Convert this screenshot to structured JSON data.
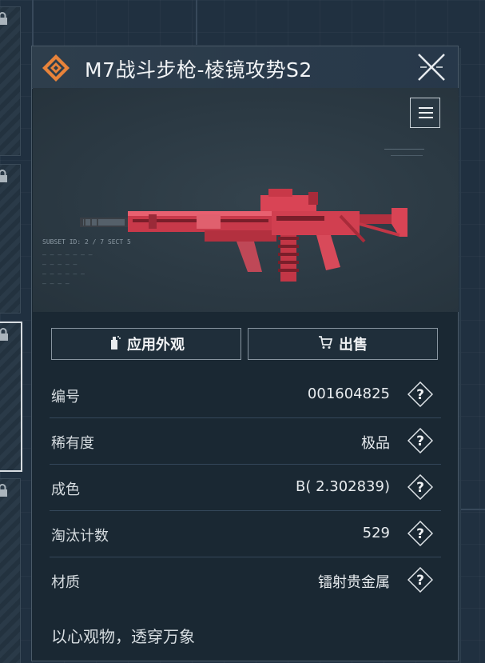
{
  "window": {
    "title": "M7战斗步枪-棱镜攻势S2"
  },
  "preview": {
    "hud_lines": [
      "SUBSET ID: 2 / 7 SECT 5",
      "— — — — — — —",
      "— — — — —",
      "— — — — — —",
      "— — — —"
    ]
  },
  "actions": {
    "apply_label": "应用外观",
    "sell_label": "出售"
  },
  "details": [
    {
      "label": "编号",
      "value": "001604825"
    },
    {
      "label": "稀有度",
      "value": "极品"
    },
    {
      "label": "成色",
      "value": "B( 2.302839)"
    },
    {
      "label": "淘汰计数",
      "value": "529"
    },
    {
      "label": "材质",
      "value": "镭射贵金属"
    }
  ],
  "flavor_text": "以心观物，透穿万象",
  "colors": {
    "accent_orange": "#e8833a",
    "weapon_red": "#d6404e",
    "panel_bg": "#1a2833"
  },
  "icons": {
    "title": "diamond-emblem-icon",
    "close": "close-icon",
    "list": "list-icon",
    "apply": "spray-can-icon",
    "sell": "cart-icon",
    "help": "question-diamond-icon",
    "lock": "lock-icon"
  }
}
